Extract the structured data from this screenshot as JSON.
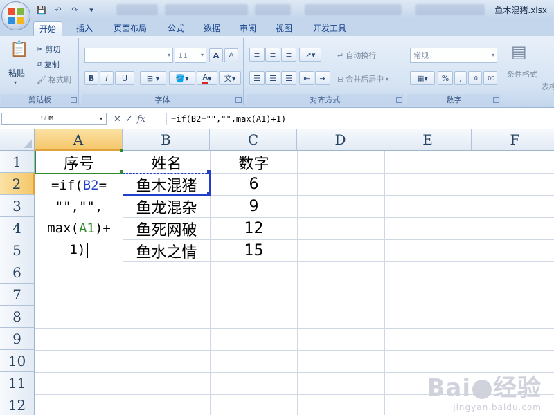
{
  "window": {
    "title": "鱼木混猪.xlsx"
  },
  "ribbon_tabs": [
    {
      "label": "开始",
      "active": true
    },
    {
      "label": "插入"
    },
    {
      "label": "页面布局"
    },
    {
      "label": "公式"
    },
    {
      "label": "数据"
    },
    {
      "label": "审阅"
    },
    {
      "label": "视图"
    },
    {
      "label": "开发工具"
    }
  ],
  "clipboard": {
    "paste": "粘贴",
    "cut": "剪切",
    "copy": "复制",
    "format_painter": "格式刷",
    "label": "剪贴板"
  },
  "font": {
    "size": "11",
    "label": "字体",
    "bold": "B",
    "italic": "I",
    "underline": "U",
    "grow": "A",
    "shrink": "A"
  },
  "alignment": {
    "wrap": "自动换行",
    "merge": "合并后居中",
    "label": "对齐方式"
  },
  "number": {
    "format": "常规",
    "percent": "%",
    "comma": ",",
    "label": "数字"
  },
  "styles": {
    "conditional": "条件格式",
    "table": "表格"
  },
  "formula_bar": {
    "name_box": "SUM",
    "cancel": "✕",
    "enter": "✓",
    "fx": "fx",
    "formula": "=if(B2=\"\",\"\",max(A1)+1)"
  },
  "columns": [
    "A",
    "B",
    "C",
    "D",
    "E",
    "F"
  ],
  "rows": [
    "1",
    "2",
    "3",
    "4",
    "5",
    "6",
    "7",
    "8",
    "9",
    "10",
    "11",
    "12"
  ],
  "cells": {
    "A1": "序号",
    "B1": "姓名",
    "C1": "数字",
    "B2": "鱼木混猪",
    "C2": "6",
    "B3": "鱼龙混杂",
    "C3": "9",
    "B4": "鱼死网破",
    "C4": "12",
    "B5": "鱼水之情",
    "C5": "15"
  },
  "editing": {
    "line1_pre": "=if(",
    "line1_ref": "B2",
    "line1_post": "=",
    "line2": "\"\",\"\",",
    "line3_pre": "max(",
    "line3_ref": "A1",
    "line3_post": ")+",
    "line4": "1)"
  },
  "watermark": {
    "logo_left": "Bai",
    "logo_right": "经验",
    "url": "jingyan.baidu.com"
  },
  "colors": {
    "ref_b": "#1f3fcc",
    "ref_a": "#2e8b2e",
    "selection_header": "#f5c76a"
  }
}
